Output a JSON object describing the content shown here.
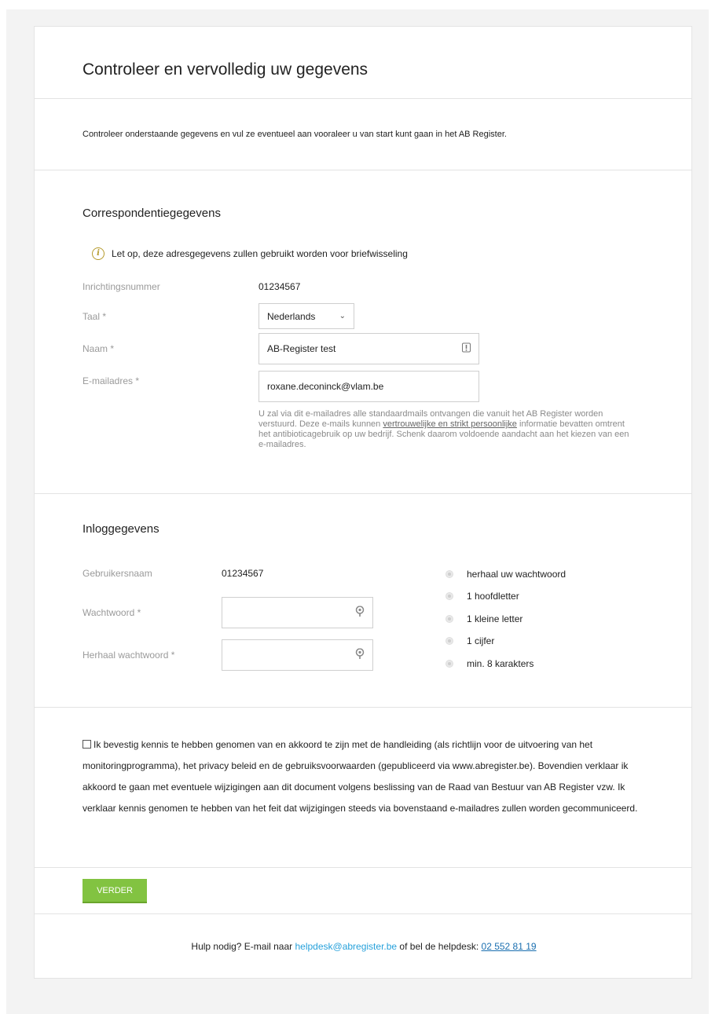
{
  "header": {
    "title": "Controleer en vervolledig uw gegevens"
  },
  "intro": {
    "text": "Controleer onderstaande gegevens en vul ze eventueel aan vooraleer u van start kunt gaan in het AB Register."
  },
  "correspondence": {
    "title": "Correspondentiegegevens",
    "notice": "Let op, deze adresgegevens zullen gebruikt worden voor briefwisseling",
    "notice_icon": "info-icon",
    "fields": {
      "inrichtingsnummer": {
        "label": "Inrichtingsnummer",
        "value": "01234567"
      },
      "taal": {
        "label": "Taal *",
        "value": "Nederlands"
      },
      "naam": {
        "label": "Naam *",
        "value": "AB-Register test"
      },
      "email": {
        "label": "E-mailadres *",
        "value": "roxane.deconinck@vlam.be"
      }
    },
    "email_help": {
      "part1": "U zal via dit e-mailadres alle standaardmails ontvangen die vanuit het AB Register worden verstuurd. Deze e-mails kunnen ",
      "emphasis": "vertrouwelijke en strikt persoonlijke",
      "part2": " informatie bevatten omtrent het antibioticagebruik op uw bedrijf. Schenk daarom voldoende aandacht aan het kiezen van een e-mailadres."
    }
  },
  "login": {
    "title": "Inloggegevens",
    "username_label": "Gebruikersnaam",
    "username_value": "01234567",
    "password_label": "Wachtwoord *",
    "password_value": "",
    "repeat_label": "Herhaal wachtwoord *",
    "repeat_value": "",
    "rules": [
      "herhaal uw wachtwoord",
      "1 hoofdletter",
      "1 kleine letter",
      "1 cijfer",
      "min. 8 karakters"
    ]
  },
  "consent": {
    "checked": false,
    "text": "Ik bevestig kennis te hebben genomen van en akkoord te zijn met de handleiding (als richtlijn voor de uitvoering van het monitoringprogramma), het privacy beleid en de gebruiksvoorwaarden (gepubliceerd via www.abregister.be). Bovendien verklaar ik akkoord te gaan met eventuele wijzigingen aan dit document volgens beslissing van de Raad van Bestuur van AB Register vzw. Ik verklaar kennis genomen te hebben van het feit dat wijzigingen steeds via bovenstaand e-mailadres zullen worden gecommuniceerd."
  },
  "actions": {
    "next_label": "Verder"
  },
  "footer": {
    "prefix": "Hulp nodig? E-mail naar ",
    "email": "helpdesk@abregister.be",
    "middle": " of bel de helpdesk: ",
    "phone": "02 552 81 19"
  },
  "colors": {
    "accent": "#82c341",
    "link": "#27a1db",
    "info": "#b59a2c"
  }
}
